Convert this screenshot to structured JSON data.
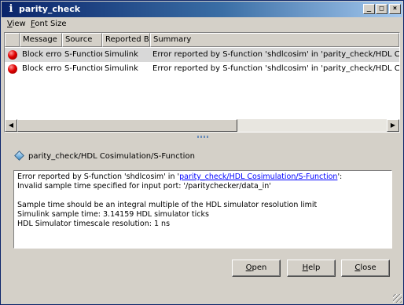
{
  "window": {
    "title": "parity_check",
    "title_icon": "i",
    "controls": {
      "minimize": "_",
      "maximize": "□",
      "close": "×"
    }
  },
  "menubar": {
    "items": [
      {
        "accel": "V",
        "rest": "iew"
      },
      {
        "accel": "F",
        "rest": "ont Size"
      }
    ]
  },
  "table": {
    "columns": [
      "Message",
      "Source",
      "Reported By",
      "Summary"
    ],
    "rows": [
      {
        "message": "Block error",
        "source": "S-Function",
        "reported_by": "Simulink",
        "summary": "Error reported by S-function 'shdlcosim' in 'parity_check/HDL Cosimulation/S-Fu"
      },
      {
        "message": "Block error",
        "source": "S-Function",
        "reported_by": "Simulink",
        "summary": "Error reported by S-function 'shdlcosim' in 'parity_check/HDL Cosimulation/S-Fu"
      }
    ]
  },
  "detail": {
    "path": "parity_check/HDL Cosimulation/S-Function",
    "message": {
      "line1_prefix": "Error reported by S-function 'shdlcosim' in '",
      "line1_link": "parity_check/HDL Cosimulation/S-Function",
      "line1_suffix": "':",
      "line2": "Invalid sample time specified for input port: '/paritychecker/data_in'",
      "line3": "Sample time should be an integral multiple of the HDL simulator resolution limit",
      "line4": "Simulink sample time: 3.14159 HDL simulator ticks",
      "line5": "HDL Simulator timescale resolution: 1 ns"
    }
  },
  "buttons": {
    "open": {
      "accel": "O",
      "rest": "pen"
    },
    "help": {
      "accel": "H",
      "rest": "elp"
    },
    "close": {
      "accel": "C",
      "rest": "lose"
    }
  },
  "colors": {
    "error": "#e00000",
    "link": "#0000ff",
    "title_start": "#0a246a"
  },
  "icons": {
    "row": "error-icon",
    "detail": "block-diamond-icon"
  }
}
